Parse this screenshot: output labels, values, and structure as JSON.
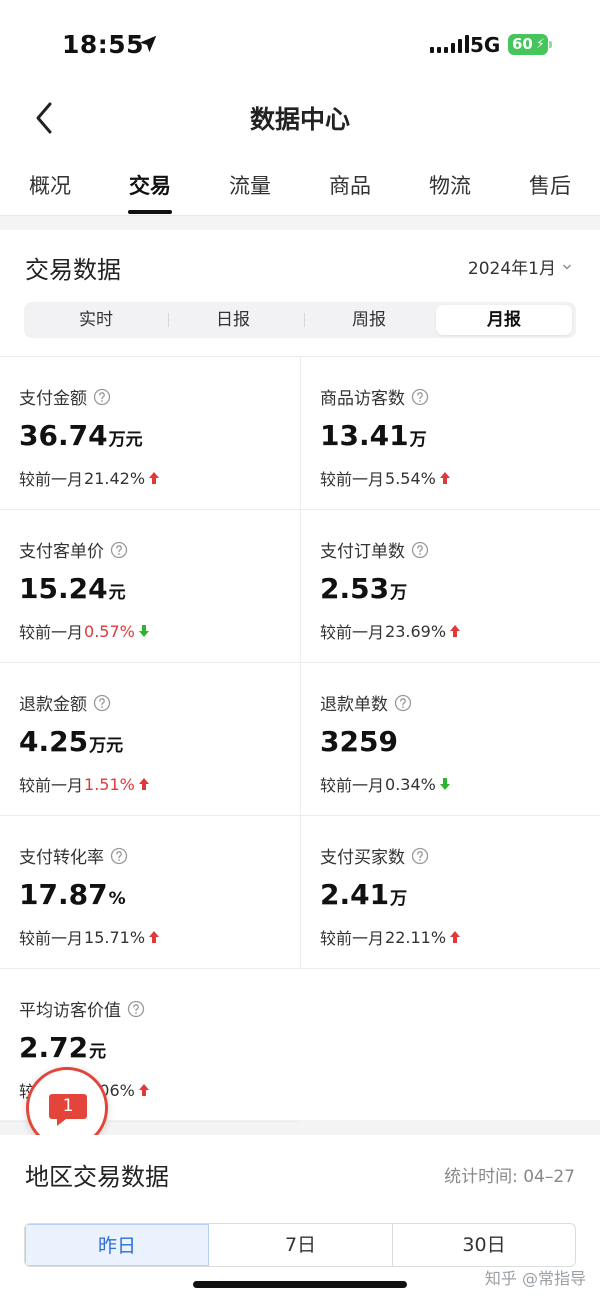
{
  "status_bar": {
    "time": "18:55",
    "network": "5G",
    "battery": "60"
  },
  "nav": {
    "title": "数据中心"
  },
  "tabs": [
    {
      "label": "概况"
    },
    {
      "label": "交易"
    },
    {
      "label": "流量"
    },
    {
      "label": "商品"
    },
    {
      "label": "物流"
    },
    {
      "label": "售后"
    }
  ],
  "active_tab": "交易",
  "trade": {
    "title": "交易数据",
    "date": "2024年1月",
    "periods": [
      {
        "label": "实时"
      },
      {
        "label": "日报"
      },
      {
        "label": "周报"
      },
      {
        "label": "月报"
      }
    ],
    "active_period": "月报",
    "compare_prefix": "较前一月",
    "metrics": [
      {
        "label": "支付金额",
        "value": "36.74",
        "unit": "万元",
        "change": "21.42%",
        "direction": "up",
        "highlight": false
      },
      {
        "label": "商品访客数",
        "value": "13.41",
        "unit": "万",
        "change": "5.54%",
        "direction": "up",
        "highlight": false
      },
      {
        "label": "支付客单价",
        "value": "15.24",
        "unit": "元",
        "change": "0.57%",
        "direction": "down",
        "highlight": true
      },
      {
        "label": "支付订单数",
        "value": "2.53",
        "unit": "万",
        "change": "23.69%",
        "direction": "up",
        "highlight": false
      },
      {
        "label": "退款金额",
        "value": "4.25",
        "unit": "万元",
        "change": "1.51%",
        "direction": "up",
        "highlight": true
      },
      {
        "label": "退款单数",
        "value": "3259",
        "unit": "",
        "change": "0.34%",
        "direction": "down",
        "highlight": false
      },
      {
        "label": "支付转化率",
        "value": "17.87",
        "unit": "%",
        "change": "15.71%",
        "direction": "up",
        "highlight": false
      },
      {
        "label": "支付买家数",
        "value": "2.41",
        "unit": "万",
        "change": "22.11%",
        "direction": "up",
        "highlight": false
      },
      {
        "label": "平均访客价值",
        "value": "2.72",
        "unit": "元",
        "change": "5.06%",
        "direction": "up",
        "highlight": false
      }
    ]
  },
  "floating_badge": {
    "count": "1"
  },
  "region": {
    "title": "地区交易数据",
    "stat_time": "统计时间: 04–27",
    "ranges": [
      {
        "label": "昨日"
      },
      {
        "label": "7日"
      },
      {
        "label": "30日"
      }
    ],
    "active_range": "昨日"
  },
  "watermark": "知乎 @常指导",
  "colors": {
    "up": "#e0393a",
    "down": "#2db42d",
    "highlight": "#e0393a",
    "accent": "#2b6fd6"
  }
}
